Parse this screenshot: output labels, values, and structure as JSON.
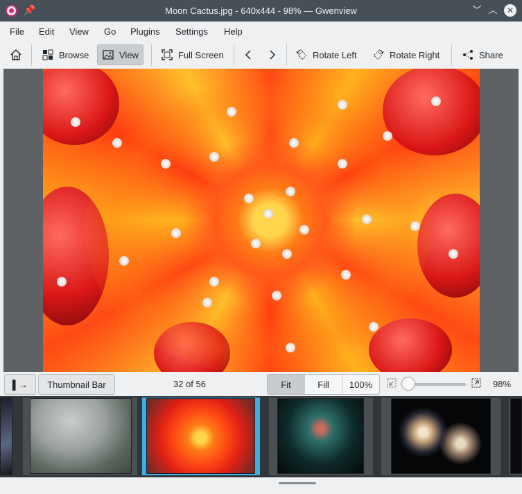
{
  "window": {
    "title": "Moon Cactus.jpg - 640x444 - 98% — Gwenview",
    "icons": [
      "gwenview-app-icon",
      "pin-icon",
      "minimize-icon",
      "maximize-icon",
      "close-icon"
    ]
  },
  "menu": [
    "File",
    "Edit",
    "View",
    "Go",
    "Plugins",
    "Settings",
    "Help"
  ],
  "toolbar": {
    "browse": "Browse",
    "view": "View",
    "fullscreen": "Full Screen",
    "rotate_left": "Rotate Left",
    "rotate_right": "Rotate Right",
    "share": "Share"
  },
  "status": {
    "thumbnail_bar": "Thumbnail Bar",
    "position": "32 of 56",
    "fit": "Fit",
    "fill": "Fill",
    "hundred": "100%",
    "zoom": "98%",
    "zoom_slider_level": 0.05
  },
  "thumbnails": [
    "Misty forest",
    "Moon Cactus",
    "Nebula",
    "Galaxies"
  ],
  "colors": {
    "accent": "#3daee9",
    "titlebar": "#475057"
  }
}
